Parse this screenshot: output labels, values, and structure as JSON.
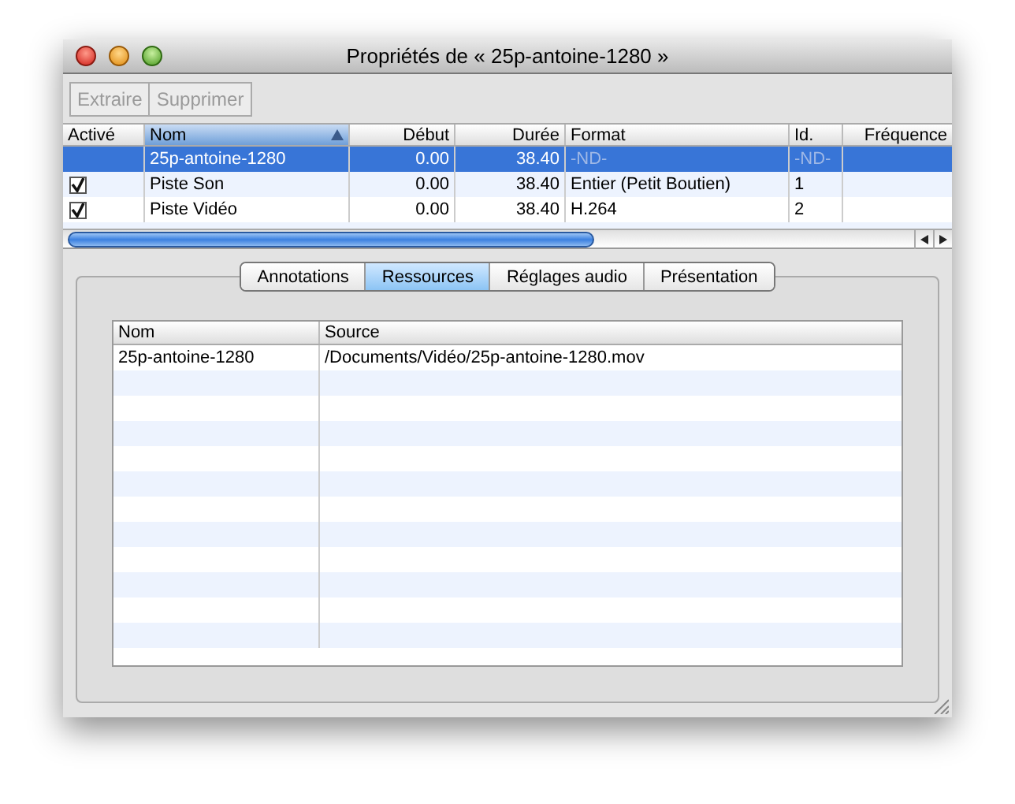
{
  "window": {
    "title": "Propriétés de « 25p-antoine-1280 »"
  },
  "toolbar": {
    "buttons": [
      {
        "label": "Extraire",
        "disabled": true
      },
      {
        "label": "Supprimer",
        "disabled": true
      }
    ]
  },
  "tracks_table": {
    "columns": [
      {
        "label": "Activé",
        "sorted": false
      },
      {
        "label": "Nom",
        "sorted": true
      },
      {
        "label": "Début",
        "sorted": false
      },
      {
        "label": "Durée",
        "sorted": false
      },
      {
        "label": "Format",
        "sorted": false
      },
      {
        "label": "Id.",
        "sorted": false
      },
      {
        "label": "Fréquence",
        "sorted": false
      }
    ],
    "rows": [
      {
        "kind": "movie",
        "selected": true,
        "name": "25p-antoine-1280",
        "start": "0.00",
        "duration": "38.40",
        "format": "-ND-",
        "id": "-ND-"
      },
      {
        "kind": "track",
        "selected": false,
        "checked": true,
        "name": "Piste Son",
        "start": "0.00",
        "duration": "38.40",
        "format": "Entier (Petit Boutien)",
        "id": "1"
      },
      {
        "kind": "track",
        "selected": false,
        "checked": true,
        "name": "Piste Vidéo",
        "start": "0.00",
        "duration": "38.40",
        "format": "H.264",
        "id": "2"
      }
    ]
  },
  "tabs": [
    {
      "label": "Annotations",
      "selected": false
    },
    {
      "label": "Ressources",
      "selected": true
    },
    {
      "label": "Réglages audio",
      "selected": false
    },
    {
      "label": "Présentation",
      "selected": false
    }
  ],
  "resources_table": {
    "columns": [
      "Nom",
      "Source"
    ],
    "rows": [
      {
        "name": "25p-antoine-1280",
        "source": "/Documents/Vidéo/25p-antoine-1280.mov"
      }
    ]
  }
}
